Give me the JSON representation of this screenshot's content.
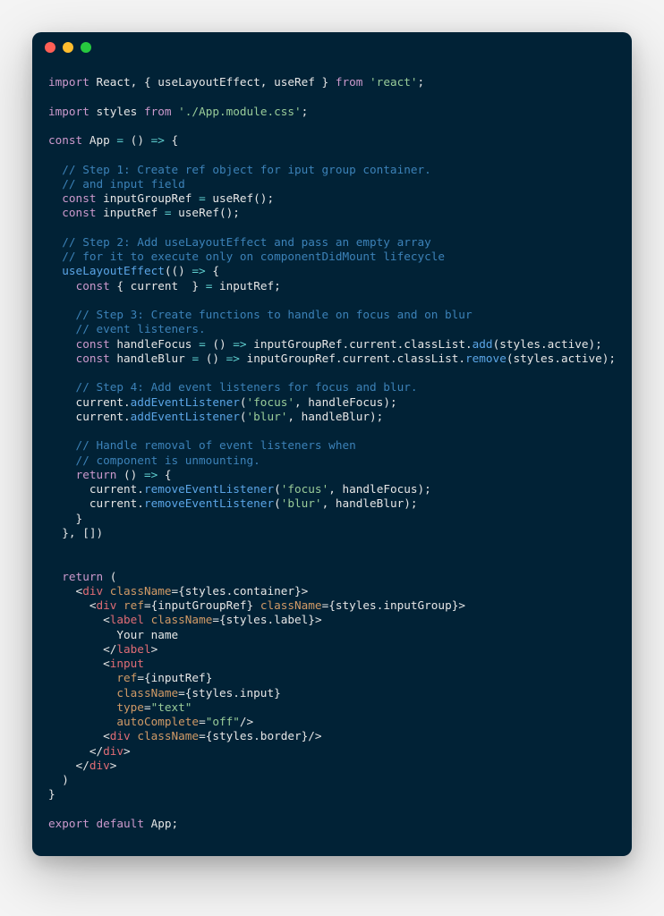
{
  "code": {
    "l1": {
      "kw1": "import",
      "id1": " React, { useLayoutEffect, useRef } ",
      "kw2": "from",
      "sp": " ",
      "str": "'react'",
      "sc": ";"
    },
    "l2": {
      "kw1": "import",
      "id1": " styles ",
      "kw2": "from",
      "sp": " ",
      "str": "'./App.module.css'",
      "sc": ";"
    },
    "l3": {
      "kw": "const",
      "id": " App ",
      "op": "=",
      "sp": " () ",
      "arrow": "=>",
      "brace": " {"
    },
    "c1a": "  // Step 1: Create ref object for iput group container.",
    "c1b": "  // and input field",
    "l4": {
      "pre": "  ",
      "kw": "const",
      "id": " inputGroupRef ",
      "op": "=",
      "rest": " useRef();"
    },
    "l5": {
      "pre": "  ",
      "kw": "const",
      "id": " inputRef ",
      "op": "=",
      "rest": " useRef();"
    },
    "c2a": "  // Step 2: Add useLayoutEffect and pass an empty array",
    "c2b": "  // for it to execute only on componentDidMount lifecycle",
    "l6": {
      "pre": "  ",
      "fn": "useLayoutEffect",
      "rest": "(() ",
      "arrow": "=>",
      "brace": " {"
    },
    "l7": {
      "pre": "    ",
      "kw": "const",
      "rest": " { current  } ",
      "op": "=",
      "tail": " inputRef;"
    },
    "c3a": "    // Step 3: Create functions to handle on focus and on blur",
    "c3b": "    // event listeners.",
    "l8": {
      "pre": "    ",
      "kw": "const",
      "id": " handleFocus ",
      "op": "=",
      "mid": " () ",
      "arrow": "=>",
      "call": " inputGroupRef.current.classList.",
      "fn": "add",
      "args": "(styles.active);"
    },
    "l9": {
      "pre": "    ",
      "kw": "const",
      "id": " handleBlur ",
      "op": "=",
      "mid": " () ",
      "arrow": "=>",
      "call": " inputGroupRef.current.classList.",
      "fn": "remove",
      "args": "(styles.active);"
    },
    "c4": "    // Step 4: Add event listeners for focus and blur.",
    "l10": {
      "pre": "    current.",
      "fn": "addEventListener",
      "o": "(",
      "s": "'focus'",
      "r": ", handleFocus);"
    },
    "l11": {
      "pre": "    current.",
      "fn": "addEventListener",
      "o": "(",
      "s": "'blur'",
      "r": ", handleBlur);"
    },
    "c5a": "    // Handle removal of event listeners when",
    "c5b": "    // component is unmounting.",
    "l12": {
      "pre": "    ",
      "kw": "return",
      "rest": " () ",
      "arrow": "=>",
      "brace": " {"
    },
    "l13": {
      "pre": "      current.",
      "fn": "removeEventListener",
      "o": "(",
      "s": "'focus'",
      "r": ", handleFocus);"
    },
    "l14": {
      "pre": "      current.",
      "fn": "removeEventListener",
      "o": "(",
      "s": "'blur'",
      "r": ", handleBlur);"
    },
    "l15": "    }",
    "l16": "  }, [])",
    "l17": {
      "pre": "  ",
      "kw": "return",
      "rest": " ("
    },
    "j1": {
      "pre": "    <",
      "tag": "div",
      "sp": " ",
      "a1": "className",
      "eq": "=",
      "v1": "{styles.container}",
      "cl": ">"
    },
    "j2": {
      "pre": "      <",
      "tag": "div",
      "sp": " ",
      "a1": "ref",
      "eq1": "=",
      "v1": "{inputGroupRef}",
      "sp2": " ",
      "a2": "className",
      "eq2": "=",
      "v2": "{styles.inputGroup}",
      "cl": ">"
    },
    "j3": {
      "pre": "        <",
      "tag": "label",
      "sp": " ",
      "a1": "className",
      "eq": "=",
      "v1": "{styles.label}",
      "cl": ">"
    },
    "j4": "          Your name",
    "j5": {
      "pre": "        </",
      "tag": "label",
      "cl": ">"
    },
    "j6": {
      "pre": "        <",
      "tag": "input"
    },
    "j7": {
      "pre": "          ",
      "a": "ref",
      "eq": "=",
      "v": "{inputRef}"
    },
    "j8": {
      "pre": "          ",
      "a": "className",
      "eq": "=",
      "v": "{styles.input}"
    },
    "j9": {
      "pre": "          ",
      "a": "type",
      "eq": "=",
      "v": "\"text\""
    },
    "j10": {
      "pre": "          ",
      "a": "autoComplete",
      "eq": "=",
      "v": "\"off\"",
      "cl": "/>"
    },
    "j11": {
      "pre": "        <",
      "tag": "div",
      "sp": " ",
      "a1": "className",
      "eq": "=",
      "v1": "{styles.border}",
      "cl": "/>"
    },
    "j12": {
      "pre": "      </",
      "tag": "div",
      "cl": ">"
    },
    "j13": {
      "pre": "    </",
      "tag": "div",
      "cl": ">"
    },
    "l18": "  )",
    "l19": "}",
    "l20": {
      "kw1": "export",
      "sp": " ",
      "kw2": "default",
      "rest": " App;"
    }
  }
}
